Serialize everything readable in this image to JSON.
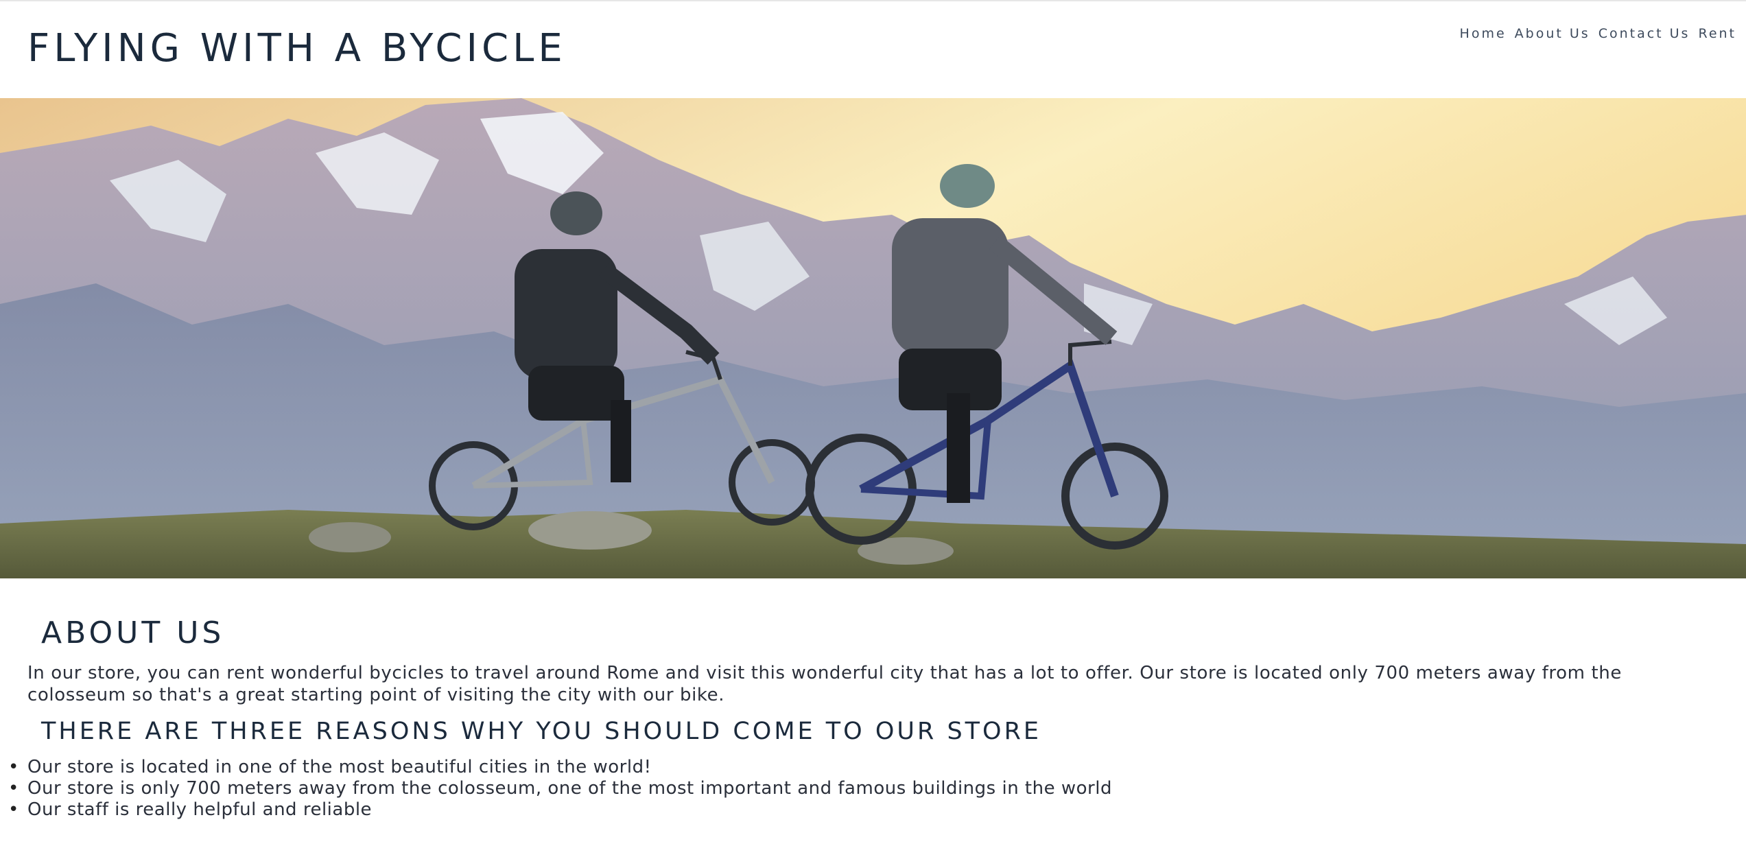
{
  "header": {
    "title": "FLYING WITH A BYCICLE",
    "nav": [
      {
        "label": "Home"
      },
      {
        "label": "About Us"
      },
      {
        "label": "Contact Us"
      },
      {
        "label": "Rent"
      }
    ]
  },
  "hero": {
    "alt": "Two mountain bikers resting on a hill overlooking snowy mountains at sunset"
  },
  "about": {
    "title": "ABOUT US",
    "text": "In our store, you can rent wonderful bycicles to travel around Rome and visit this wonderful city that has a lot to offer. Our store is located only 700 meters away from the colosseum so that's a great starting point of visiting the city with our bike."
  },
  "reasons": {
    "title": "THERE ARE THREE REASONS WHY YOU SHOULD COME TO OUR STORE",
    "items": [
      "Our store is located in one of the most beautiful cities in the world!",
      "Our store is only 700 meters away from the colosseum, one of the most important and famous buildings in the world",
      "Our staff is really helpful and reliable"
    ]
  },
  "colors": {
    "text_dark": "#1b2a3c",
    "sky_top": "#f3d9a2",
    "mountain": "#8b97b0"
  }
}
